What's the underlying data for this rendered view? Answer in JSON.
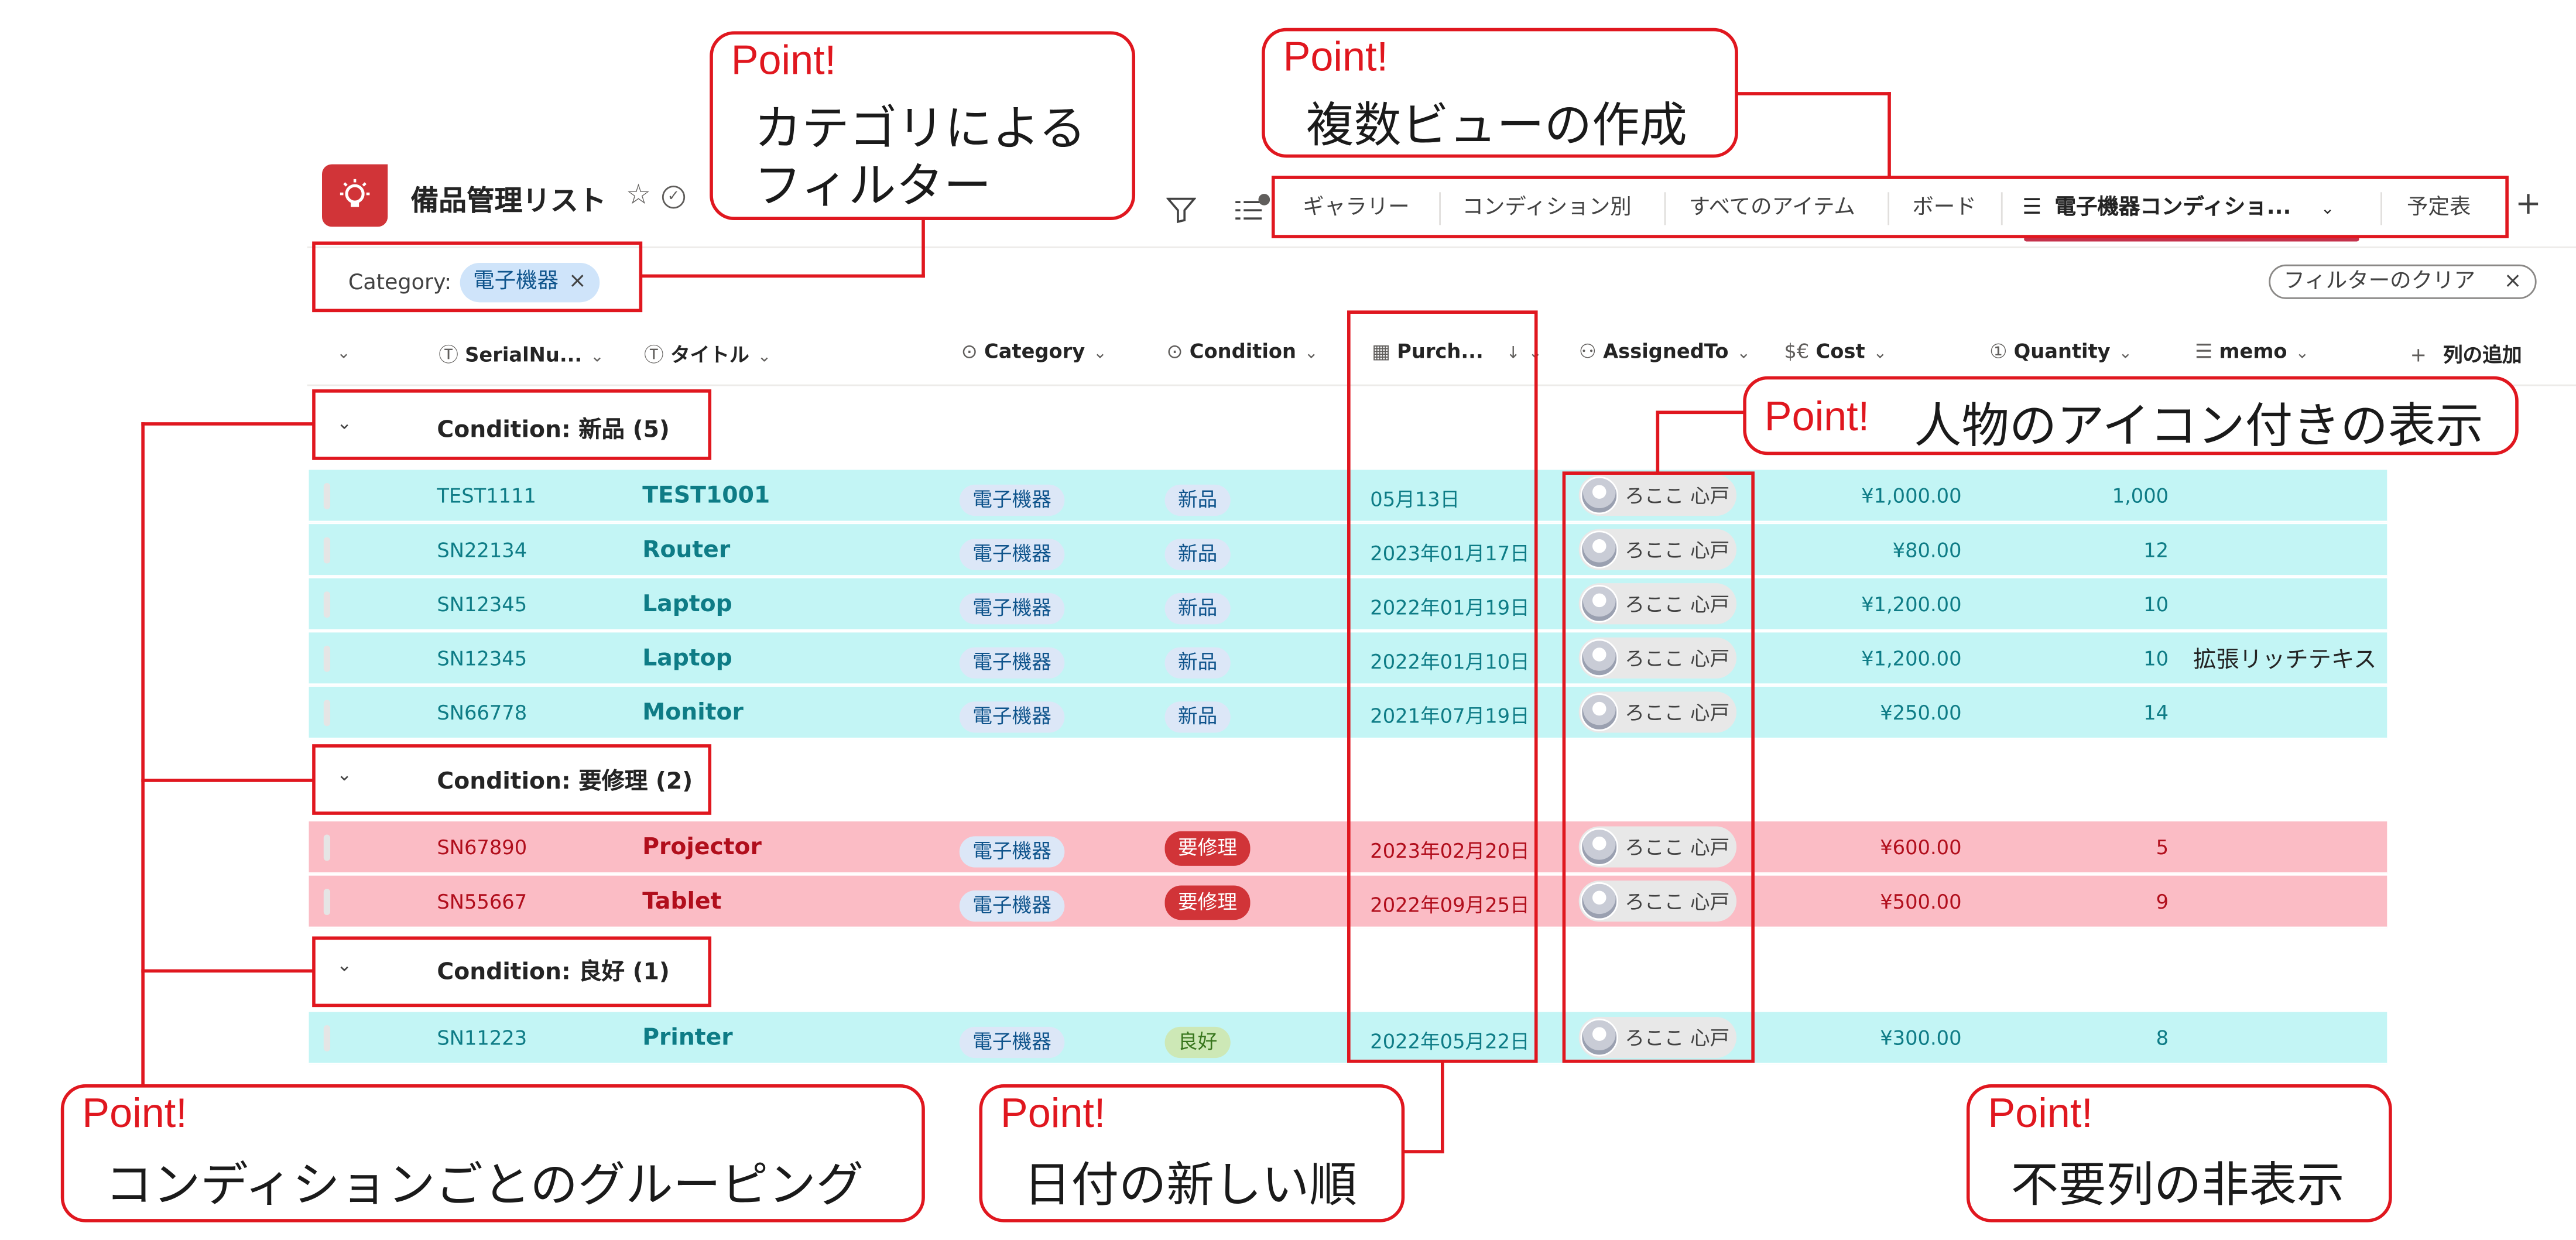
{
  "list": {
    "title": "備品管理リスト",
    "star_icon": "☆",
    "check_icon": "✓"
  },
  "tabs": [
    {
      "label": "ギャラリー"
    },
    {
      "label": "コンディション別"
    },
    {
      "label": "すべてのアイテム"
    },
    {
      "label": "ボード"
    },
    {
      "label": "電子機器コンディショ...",
      "active": true
    },
    {
      "label": "予定表"
    }
  ],
  "filter": {
    "label": "Category:",
    "chip": "電子機器",
    "chip_close": "×",
    "clear_label": "フィルターのクリア",
    "clear_close": "×"
  },
  "columns": {
    "serial": "SerialNu...",
    "title": "タイトル",
    "category": "Category",
    "condition": "Condition",
    "purchase": "Purch...",
    "purchase_sort": "↓",
    "assigned": "AssignedTo",
    "cost": "Cost",
    "quantity": "Quantity",
    "memo": "memo",
    "add_column": "列の追加"
  },
  "groups": [
    {
      "label": "Condition: 新品 (5)"
    },
    {
      "label": "Condition: 要修理 (2)"
    },
    {
      "label": "Condition: 良好 (1)"
    }
  ],
  "rows": [
    {
      "serial": "TEST1111",
      "title": "TEST1001",
      "category": "電子機器",
      "condition": "新品",
      "purchase": "05月13日",
      "assigned": "ろここ 心戸",
      "cost": "¥1,000.00",
      "quantity": "1,000",
      "memo": ""
    },
    {
      "serial": "SN22134",
      "title": "Router",
      "category": "電子機器",
      "condition": "新品",
      "purchase": "2023年01月17日",
      "assigned": "ろここ 心戸",
      "cost": "¥80.00",
      "quantity": "12",
      "memo": ""
    },
    {
      "serial": "SN12345",
      "title": "Laptop",
      "category": "電子機器",
      "condition": "新品",
      "purchase": "2022年01月19日",
      "assigned": "ろここ 心戸",
      "cost": "¥1,200.00",
      "quantity": "10",
      "memo": ""
    },
    {
      "serial": "SN12345",
      "title": "Laptop",
      "category": "電子機器",
      "condition": "新品",
      "purchase": "2022年01月10日",
      "assigned": "ろここ 心戸",
      "cost": "¥1,200.00",
      "quantity": "10",
      "memo": "拡張リッチテキス"
    },
    {
      "serial": "SN66778",
      "title": "Monitor",
      "category": "電子機器",
      "condition": "新品",
      "purchase": "2021年07月19日",
      "assigned": "ろここ 心戸",
      "cost": "¥250.00",
      "quantity": "14",
      "memo": ""
    },
    {
      "serial": "SN67890",
      "title": "Projector",
      "category": "電子機器",
      "condition": "要修理",
      "purchase": "2023年02月20日",
      "assigned": "ろここ 心戸",
      "cost": "¥600.00",
      "quantity": "5",
      "memo": ""
    },
    {
      "serial": "SN55667",
      "title": "Tablet",
      "category": "電子機器",
      "condition": "要修理",
      "purchase": "2022年09月25日",
      "assigned": "ろここ 心戸",
      "cost": "¥500.00",
      "quantity": "9",
      "memo": ""
    },
    {
      "serial": "SN11223",
      "title": "Printer",
      "category": "電子機器",
      "condition": "良好",
      "purchase": "2022年05月22日",
      "assigned": "ろここ 心戸",
      "cost": "¥300.00",
      "quantity": "8",
      "memo": ""
    }
  ],
  "callouts": {
    "point_label": "Point!",
    "category_filter_line1": "カテゴリによる",
    "category_filter_line2": "フィルター",
    "multiple_views": "複数ビューの作成",
    "person_icon": "人物のアイコン付きの表示",
    "grouping": "コンディションごとのグルーピング",
    "date_sort": "日付の新しい順",
    "hide_columns": "不要列の非表示"
  },
  "colors": {
    "accent_red": "#e0171f",
    "row_new": "#c3f5f5",
    "row_repair": "#fbbcc5",
    "list_icon": "#d13438"
  }
}
